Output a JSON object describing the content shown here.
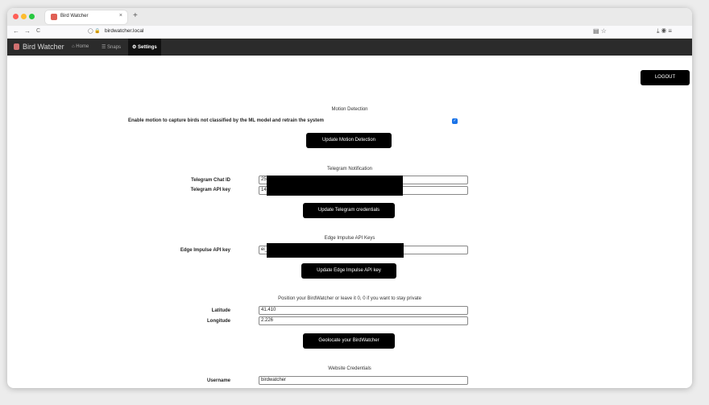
{
  "browser": {
    "tab_title": "Bird Watcher",
    "tab_close": "×",
    "new_tab": "+",
    "url": "birdwatcher.local",
    "nav_back": "←",
    "nav_forward": "→",
    "nav_reload": "C",
    "url_icons": "◯ 🔒",
    "right_icons_1": "▤ ☆",
    "right_icons_2": "⤓ ◉ ≡"
  },
  "navbar": {
    "brand": "Bird Watcher",
    "home": "⌂ Home",
    "snaps": "☰ Snaps",
    "settings": "⚙ Settings"
  },
  "logout_label": "LOGOUT",
  "motion": {
    "title": "Motion Detection",
    "label": "Enable motion to capture birds not classified by the ML model and retrain the system",
    "checked": true,
    "checkbox_glyph": "✓",
    "button": "Update Motion Detection"
  },
  "telegram": {
    "title": "Telegram Notification",
    "chat_id_label": "Telegram Chat ID",
    "chat_id_value": "25",
    "api_key_label": "Telegram API key",
    "api_key_value": "14",
    "button": "Update Telegram credentials"
  },
  "edge": {
    "title": "Edge Impulse API Keys",
    "api_key_label": "Edge Impulse API key",
    "api_key_value": "ei_",
    "button": "Update Edge Impulse API key"
  },
  "geo": {
    "title": "Position your BirdWatcher or leave it 0, 0 if you want to stay private",
    "latitude_label": "Latitude",
    "latitude_value": "41.410",
    "longitude_label": "Longitude",
    "longitude_value": "2.226",
    "button": "Geolocate your BirdWatcher"
  },
  "credentials": {
    "title": "Website Credentials",
    "username_label": "Username",
    "username_value": "birdwatcher"
  }
}
